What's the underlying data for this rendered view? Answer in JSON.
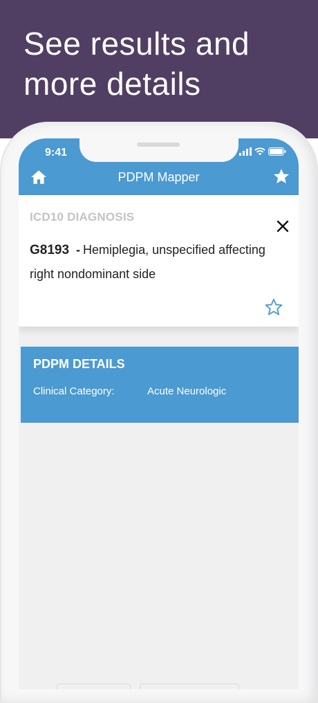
{
  "headline": {
    "line1": "See results and",
    "line2": "more details"
  },
  "status_bar": {
    "time": "9:41"
  },
  "nav": {
    "title": "PDPM Mapper",
    "home_icon": "home-icon",
    "favorites_icon": "star-icon"
  },
  "diagnosis_card": {
    "label": "ICD10 DIAGNOSIS",
    "code": "G8193",
    "separator": "-",
    "description": "Hemiplegia, unspecified affecting right nondominant side"
  },
  "pdpm_details": {
    "title": "PDPM DETAILS",
    "rows": [
      {
        "key": "Clinical Category:",
        "value": "Acute Neurologic"
      }
    ]
  },
  "colors": {
    "banner": "#503f62",
    "accent": "#4b9ad1",
    "screen_bg": "#f0f0f0"
  }
}
